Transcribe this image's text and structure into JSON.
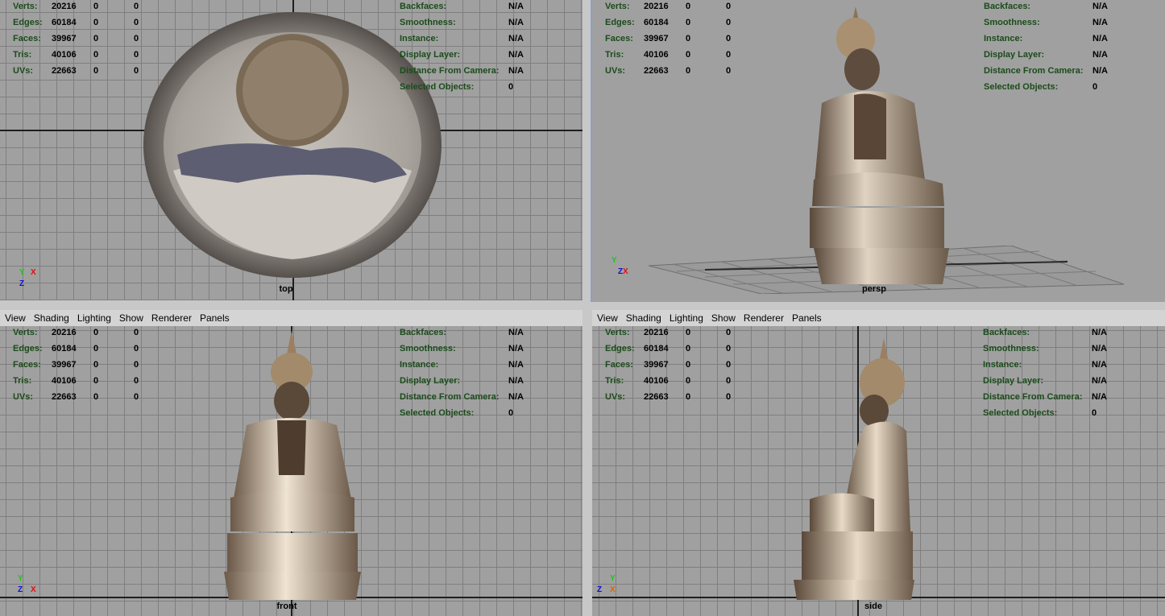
{
  "menu": [
    "View",
    "Shading",
    "Lighting",
    "Show",
    "Renderer",
    "Panels"
  ],
  "hud_left": [
    {
      "label": "Verts:",
      "v1": "20216",
      "v2": "0",
      "v3": "0"
    },
    {
      "label": "Edges:",
      "v1": "60184",
      "v2": "0",
      "v3": "0"
    },
    {
      "label": "Faces:",
      "v1": "39967",
      "v2": "0",
      "v3": "0"
    },
    {
      "label": "Tris:",
      "v1": "40106",
      "v2": "0",
      "v3": "0"
    },
    {
      "label": "UVs:",
      "v1": "22663",
      "v2": "0",
      "v3": "0"
    }
  ],
  "hud_right": [
    {
      "label": "Backfaces:",
      "value": "N/A"
    },
    {
      "label": "Smoothness:",
      "value": "N/A"
    },
    {
      "label": "Instance:",
      "value": "N/A"
    },
    {
      "label": "Display Layer:",
      "value": "N/A"
    },
    {
      "label": "Distance From Camera:",
      "value": "N/A"
    },
    {
      "label": "Selected Objects:",
      "value": "0"
    }
  ],
  "viewports": {
    "top": {
      "camera": "top",
      "gizmo": [
        "Y",
        "X",
        "Z"
      ]
    },
    "persp": {
      "camera": "persp",
      "gizmo": [
        "Y",
        "Z",
        "X"
      ]
    },
    "front": {
      "camera": "front",
      "gizmo": [
        "Y",
        "Z",
        "X"
      ]
    },
    "side": {
      "camera": "side",
      "gizmo": [
        "Y",
        "Z",
        "X"
      ]
    }
  },
  "colors": {
    "hud_label": "#1b4b1b",
    "viewport_bg": "#a0a0a0",
    "grid": "#7f7f7f",
    "axis_x": "#d11",
    "axis_y": "#1c1",
    "axis_z": "#11c",
    "active_border": "#8aa0c8"
  }
}
